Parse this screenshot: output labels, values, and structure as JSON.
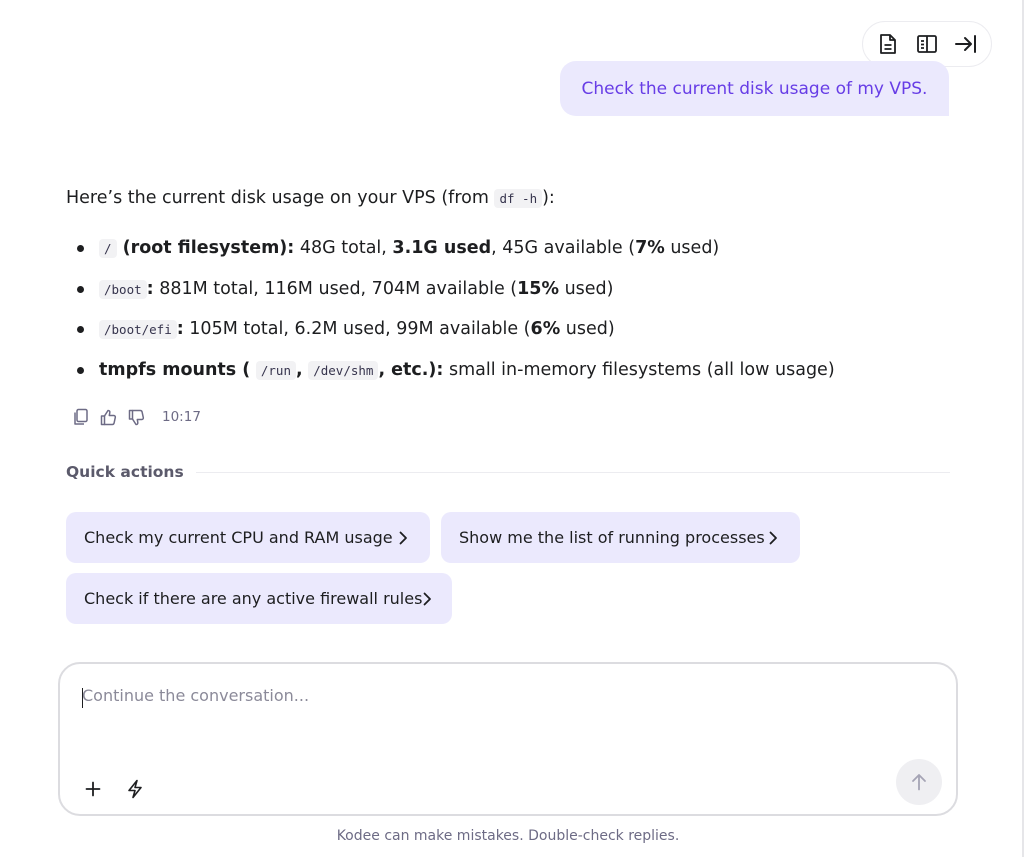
{
  "toolbar": {
    "icons": [
      "document-icon",
      "split-view-icon",
      "collapse-right-icon"
    ]
  },
  "user_message": "Check the current disk usage of my VPS.",
  "assistant": {
    "intro_before": "Here’s the current disk usage on your VPS (from ",
    "intro_code": "df -h",
    "intro_after": "):",
    "items": [
      {
        "code": "/",
        "bold": " (root filesystem):",
        "t1": " 48G total, ",
        "b1": "3.1G used",
        "t2": ", 45G available (",
        "b2": "7%",
        "t3": " used)"
      },
      {
        "code": "/boot",
        "colon": ":",
        "t1": " 881M total, 116M used, 704M available (",
        "b1": "15%",
        "t2": " used)"
      },
      {
        "code": "/boot/efi",
        "colon": ":",
        "t1": " 105M total, 6.2M used, 99M available (",
        "b1": "6%",
        "t2": " used)"
      },
      {
        "bold_start": "tmpfs mounts (",
        "code1": "/run",
        "sep": ",",
        "code2": "/dev/shm",
        "bold_end": ", etc.):",
        "t1": " small in-memory filesystems (all low usage)"
      }
    ],
    "time": "10:17"
  },
  "quick_actions": {
    "title": "Quick actions",
    "items": [
      "Check my current CPU and RAM usage",
      "Show me the list of running processes",
      "Check if there are any active firewall rules"
    ]
  },
  "composer": {
    "placeholder": "Continue the conversation..."
  },
  "footer": {
    "disclaimer": "Kodee can make mistakes. Double-check replies."
  },
  "colors": {
    "accent": "#673de6",
    "bubble_bg": "#ebe9fd",
    "text": "#1d1e20"
  }
}
